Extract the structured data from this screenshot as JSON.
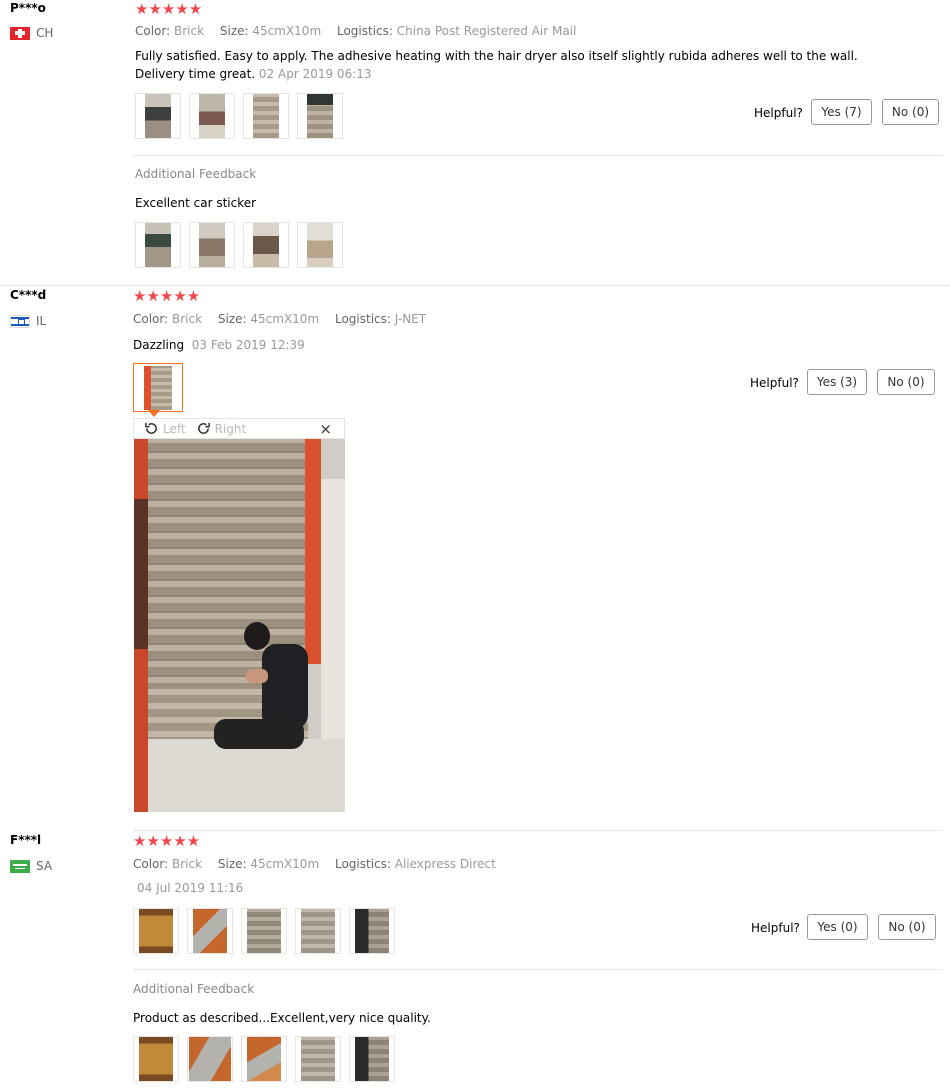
{
  "reviews": [
    {
      "user": "P***o",
      "country": "CH",
      "stars": "★★★★★",
      "color_label": "Color:",
      "color_value": "Brick",
      "size_label": "Size:",
      "size_value": "45cmX10m",
      "logistics_label": "Logistics:",
      "logistics_value": "China Post Registered Air Mail",
      "text_line1": "Fully satisfied. Easy to apply. The adhesive heating with the hair dryer also itself slightly rubida adheres well to the wall.",
      "text_line2": "Delivery time great.",
      "date": "02 Apr 2019 06:13",
      "helpful_label": "Helpful?",
      "yes_label": "Yes (7)",
      "no_label": "No (0)",
      "additional_title": "Additional Feedback",
      "additional_text": "Excellent car sticker"
    },
    {
      "user": "C***d",
      "country": "IL",
      "stars": "★★★★★",
      "color_label": "Color:",
      "color_value": "Brick",
      "size_label": "Size:",
      "size_value": "45cmX10m",
      "logistics_label": "Logistics:",
      "logistics_value": "J-NET",
      "text_line1": "Dazzling",
      "date": "03 Feb 2019 12:39",
      "helpful_label": "Helpful?",
      "yes_label": "Yes (3)",
      "no_label": "No (0)",
      "viewer": {
        "rotate_left": "Left",
        "rotate_right": "Right",
        "close": "×"
      }
    },
    {
      "user": "F***l",
      "country": "SA",
      "stars": "★★★★★",
      "color_label": "Color:",
      "color_value": "Brick",
      "size_label": "Size:",
      "size_value": "45cmX10m",
      "logistics_label": "Logistics:",
      "logistics_value": "Aliexpress Direct",
      "date": "04 Jul 2019 11:16",
      "helpful_label": "Helpful?",
      "yes_label": "Yes (0)",
      "no_label": "No (0)",
      "additional_title": "Additional Feedback",
      "additional_text": "Product as described...Excellent,very nice quality."
    }
  ],
  "colors": {
    "star": "#f0484f",
    "accent": "#f57224",
    "brick": "#a99a88",
    "wall_orange": "#d8532c"
  }
}
